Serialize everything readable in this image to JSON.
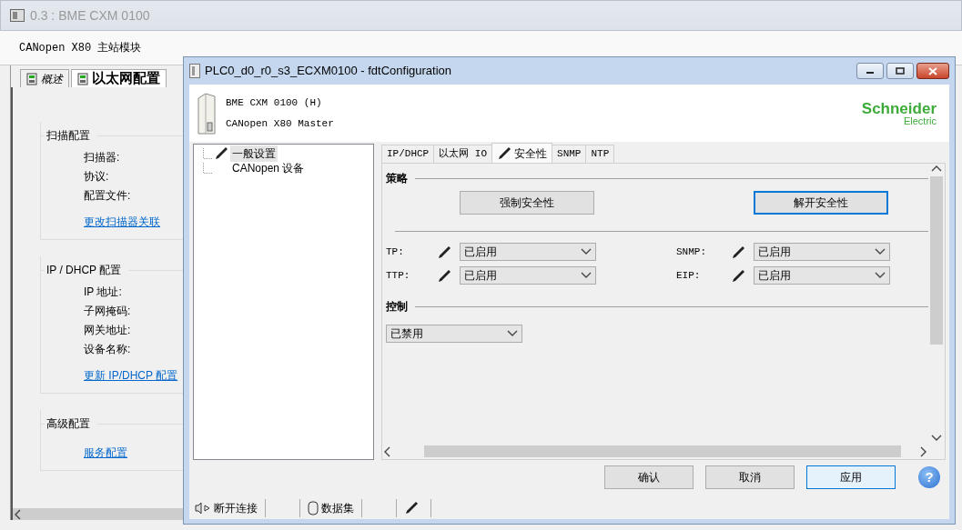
{
  "main_window": {
    "title": "0.3 : BME CXM 0100",
    "subtitle": "CANopen X80 主站模块",
    "tabs": [
      {
        "label": "概述",
        "selected": false
      },
      {
        "label": "以太网配置",
        "selected": true
      }
    ],
    "groups": [
      {
        "title": "扫描配置",
        "fields": [
          "扫描器:",
          "协议:",
          "配置文件:"
        ],
        "link": "更改扫描器关联"
      },
      {
        "title": "IP / DHCP 配置",
        "fields": [
          "IP 地址:",
          "子网掩码:",
          "网关地址:",
          "设备名称:"
        ],
        "link": "更新 IP/DHCP 配置"
      },
      {
        "title": "高级配置",
        "link": "服务配置"
      }
    ]
  },
  "dialog": {
    "title": "PLC0_d0_r0_s3_ECXM0100 - fdtConfiguration",
    "device": {
      "name": "BME CXM 0100 (H)",
      "description": "CANopen X80 Master"
    },
    "logo": {
      "brand": "Schneider",
      "sub": "Electric"
    },
    "tree": [
      {
        "label": "一般设置",
        "selected": true,
        "modified": true
      },
      {
        "label": "CANopen 设备",
        "selected": false,
        "modified": false
      }
    ],
    "tabs": [
      {
        "label": "IP/DHCP",
        "selected": false,
        "modified": false
      },
      {
        "label": "以太网 IO",
        "selected": false,
        "modified": false
      },
      {
        "label": "安全性",
        "selected": true,
        "modified": true
      },
      {
        "label": "SNMP",
        "selected": false,
        "modified": false
      },
      {
        "label": "NTP",
        "selected": false,
        "modified": false
      }
    ],
    "sections": [
      {
        "kind": "buttons",
        "title": "策略",
        "buttons": [
          {
            "label": "强制安全性",
            "focused": false
          },
          {
            "label": "解开安全性",
            "focused": true
          }
        ]
      },
      {
        "kind": "services",
        "items": [
          {
            "label": "TP:",
            "value": "已启用"
          },
          {
            "label": "SNMP:",
            "value": "已启用"
          },
          {
            "label": "TTP:",
            "value": "已启用"
          },
          {
            "label": "EIP:",
            "value": "已启用"
          }
        ]
      },
      {
        "kind": "select",
        "title": "控制",
        "value": "已禁用"
      }
    ],
    "buttons": [
      {
        "label": "确认",
        "focused": false
      },
      {
        "label": "取消",
        "focused": false
      },
      {
        "label": "应用",
        "focused": true
      }
    ],
    "help": "?",
    "status_bar": [
      {
        "kind": "connection",
        "label": "断开连接"
      },
      {
        "kind": "dataset",
        "label": "数据集"
      },
      {
        "kind": "edit"
      }
    ]
  }
}
